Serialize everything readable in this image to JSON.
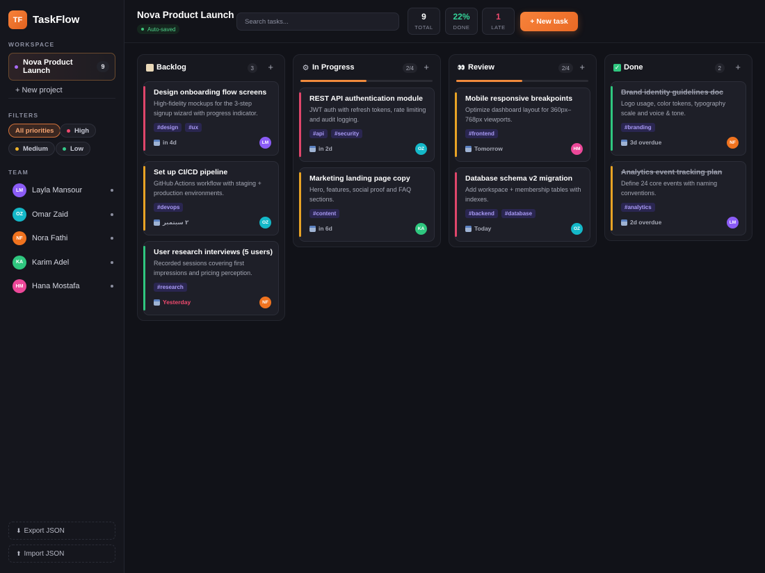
{
  "app": {
    "name": "TaskFlow",
    "logo": "TF"
  },
  "sidebar": {
    "workspace_label": "WORKSPACE",
    "project": {
      "name": "Nova Product Launch",
      "count": "9"
    },
    "new_project": "+ New project",
    "filters_label": "FILTERS",
    "filters": [
      {
        "label": "All priorities",
        "color": "",
        "active": true
      },
      {
        "label": "High",
        "color": "#ef4a6e",
        "active": false
      },
      {
        "label": "Medium",
        "color": "#f0b429",
        "active": false
      },
      {
        "label": "Low",
        "color": "#34c98a",
        "active": false
      }
    ],
    "team_label": "TEAM",
    "team": [
      {
        "initials": "LM",
        "name": "Layla Mansour",
        "color": "#8b5cf6"
      },
      {
        "initials": "OZ",
        "name": "Omar Zaid",
        "color": "#14b8c8"
      },
      {
        "initials": "NF",
        "name": "Nora Fathi",
        "color": "#f0731f"
      },
      {
        "initials": "KA",
        "name": "Karim Adel",
        "color": "#2fc77f"
      },
      {
        "initials": "HM",
        "name": "Hana Mostafa",
        "color": "#ec4899"
      }
    ],
    "export": "Export JSON",
    "import": "Import JSON"
  },
  "header": {
    "title": "Nova Product Launch",
    "autosave": "Auto-saved",
    "search_placeholder": "Search tasks...",
    "stats": [
      {
        "value": "9",
        "label": "TOTAL",
        "color": "#ffffff"
      },
      {
        "value": "22%",
        "label": "DONE",
        "color": "#34d399"
      },
      {
        "value": "1",
        "label": "LATE",
        "color": "#ef4a6e"
      }
    ],
    "new_task": "+ New task"
  },
  "columns": [
    {
      "title": "Backlog",
      "icon": "clipboard-icon",
      "count": "3",
      "progress": null,
      "cards": [
        {
          "title": "Design onboarding flow screens",
          "desc": "High-fidelity mockups for the 3-step signup wizard with progress indicator.",
          "tags": [
            "#design",
            "#ux"
          ],
          "due": "in 4d",
          "late": false,
          "assignee": "LM",
          "assignee_color": "#8b5cf6",
          "priority_color": "#e0466b",
          "done": false
        },
        {
          "title": "Set up CI/CD pipeline",
          "desc": "GitHub Actions workflow with staging + production environments.",
          "tags": [
            "#devops"
          ],
          "due": "٢ سبتمبر",
          "late": false,
          "assignee": "OZ",
          "assignee_color": "#14b8c8",
          "priority_color": "#e8a325",
          "done": false
        },
        {
          "title": "User research interviews (5 users)",
          "desc": "Recorded sessions covering first impressions and pricing perception.",
          "tags": [
            "#research"
          ],
          "due": "Yesterday",
          "late": true,
          "assignee": "NF",
          "assignee_color": "#f0731f",
          "priority_color": "#2fc77f",
          "done": false
        }
      ]
    },
    {
      "title": "In Progress",
      "icon": "gear-icon",
      "count": "2/4",
      "progress": 0.5,
      "cards": [
        {
          "title": "REST API authentication module",
          "desc": "JWT auth with refresh tokens, rate limiting and audit logging.",
          "tags": [
            "#api",
            "#security"
          ],
          "due": "in 2d",
          "late": false,
          "assignee": "OZ",
          "assignee_color": "#14b8c8",
          "priority_color": "#e0466b",
          "done": false
        },
        {
          "title": "Marketing landing page copy",
          "desc": "Hero, features, social proof and FAQ sections.",
          "tags": [
            "#content"
          ],
          "due": "in 6d",
          "late": false,
          "assignee": "KA",
          "assignee_color": "#2fc77f",
          "priority_color": "#e8a325",
          "done": false
        }
      ]
    },
    {
      "title": "Review",
      "icon": "eyes-icon",
      "count": "2/4",
      "progress": 0.5,
      "cards": [
        {
          "title": "Mobile responsive breakpoints",
          "desc": "Optimize dashboard layout for 360px–768px viewports.",
          "tags": [
            "#frontend"
          ],
          "due": "Tomorrow",
          "late": false,
          "assignee": "HM",
          "assignee_color": "#ec4899",
          "priority_color": "#e8a325",
          "done": false
        },
        {
          "title": "Database schema v2 migration",
          "desc": "Add workspace + membership tables with indexes.",
          "tags": [
            "#backend",
            "#database"
          ],
          "due": "Today",
          "late": false,
          "assignee": "OZ",
          "assignee_color": "#14b8c8",
          "priority_color": "#e0466b",
          "done": false
        }
      ]
    },
    {
      "title": "Done",
      "icon": "check-icon",
      "count": "2",
      "progress": null,
      "cards": [
        {
          "title": "Brand identity guidelines doc",
          "desc": "Logo usage, color tokens, typography scale and voice & tone.",
          "tags": [
            "#branding"
          ],
          "due": "3d overdue",
          "late": false,
          "assignee": "NF",
          "assignee_color": "#f0731f",
          "priority_color": "#2fc77f",
          "done": true
        },
        {
          "title": "Analytics event tracking plan",
          "desc": "Define 24 core events with naming conventions.",
          "tags": [
            "#analytics"
          ],
          "due": "2d overdue",
          "late": false,
          "assignee": "LM",
          "assignee_color": "#8b5cf6",
          "priority_color": "#e8a325",
          "done": true
        }
      ]
    }
  ]
}
